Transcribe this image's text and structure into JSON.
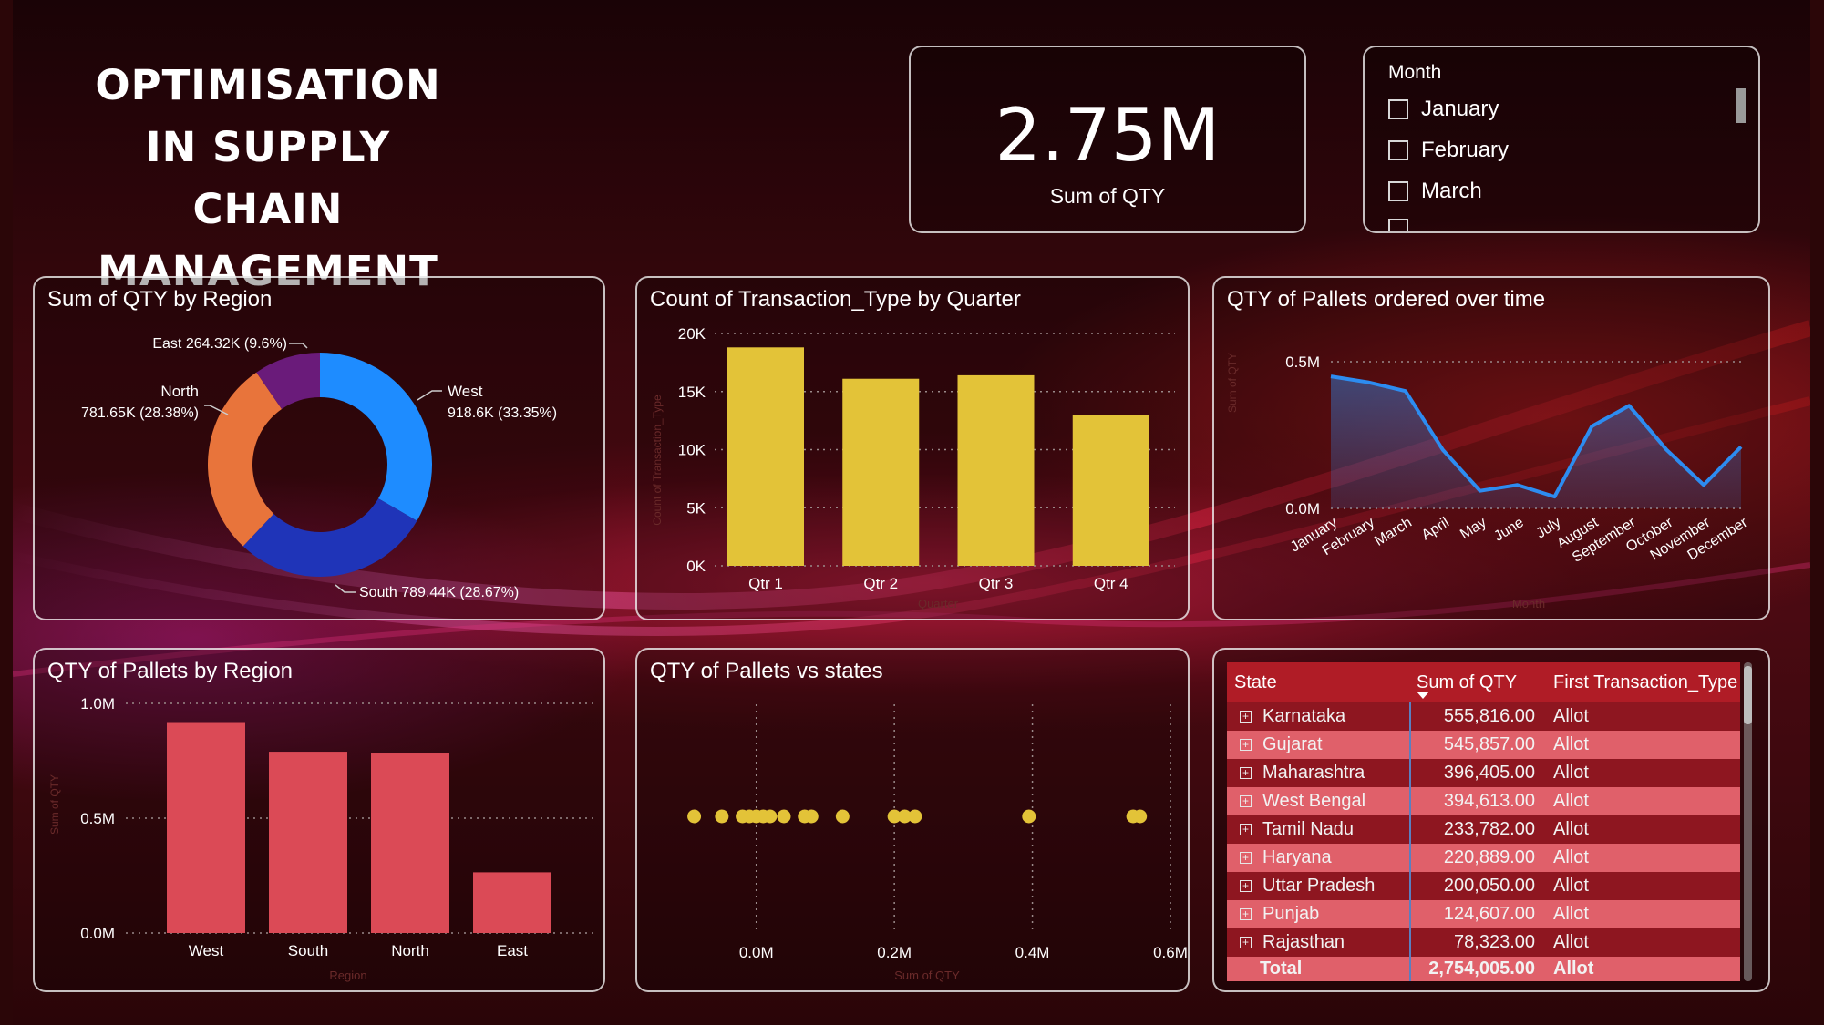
{
  "dashboard": {
    "title_line1": "OPTIMISATION IN SUPPLY",
    "title_line2": "CHAIN MANAGEMENT"
  },
  "kpi": {
    "value": "2.75M",
    "label": "Sum of QTY"
  },
  "month_slicer": {
    "title": "Month",
    "items": [
      "January",
      "February",
      "March"
    ]
  },
  "donut": {
    "title": "Sum of QTY by Region",
    "labels": {
      "east": "East 264.32K (9.6%)",
      "north_name": "North",
      "north_value": "781.65K (28.38%)",
      "west_name": "West",
      "west_value": "918.6K (33.35%)",
      "south": "South 789.44K (28.67%)"
    }
  },
  "quarter_chart": {
    "title": "Count of Transaction_Type by Quarter",
    "xlabel": "Quarter",
    "ylabel": "Count of Transaction_Type"
  },
  "time_chart": {
    "title": "QTY of Pallets ordered over time",
    "xlabel": "Month",
    "ylabel": "Sum of QTY"
  },
  "region_bar_chart": {
    "title": "QTY of Pallets by Region",
    "xlabel": "Region",
    "ylabel": "Sum of QTY"
  },
  "scatter_chart": {
    "title": "QTY of Pallets vs states",
    "xlabel": "Sum of QTY"
  },
  "state_table": {
    "headers": [
      "State",
      "Sum of QTY",
      "First Transaction_Type"
    ],
    "rows": [
      {
        "state": "Karnataka",
        "qty": "555,816.00",
        "type": "Allot"
      },
      {
        "state": "Gujarat",
        "qty": "545,857.00",
        "type": "Allot"
      },
      {
        "state": "Maharashtra",
        "qty": "396,405.00",
        "type": "Allot"
      },
      {
        "state": "West Bengal",
        "qty": "394,613.00",
        "type": "Allot"
      },
      {
        "state": "Tamil Nadu",
        "qty": "233,782.00",
        "type": "Allot"
      },
      {
        "state": "Haryana",
        "qty": "220,889.00",
        "type": "Allot"
      },
      {
        "state": "Uttar Pradesh",
        "qty": "200,050.00",
        "type": "Allot"
      },
      {
        "state": "Punjab",
        "qty": "124,607.00",
        "type": "Allot"
      },
      {
        "state": "Rajasthan",
        "qty": "78,323.00",
        "type": "Allot"
      }
    ],
    "total": {
      "state": "Total",
      "qty": "2,754,005.00",
      "type": "Allot"
    }
  },
  "colors": {
    "west": "#1e8cff",
    "south": "#1f34b8",
    "north": "#e8743b",
    "east": "#6a1b7a",
    "yellow_bar": "#e3c338",
    "red_bar": "#db4a56",
    "line": "#2d8cf0",
    "table_header": "#b01c26",
    "table_dark_row": "#8e1620",
    "table_light_row": "#e0606a"
  },
  "chart_data": [
    {
      "type": "pie",
      "title": "Sum of QTY by Region",
      "categories": [
        "West",
        "South",
        "North",
        "East"
      ],
      "values": [
        918600,
        789440,
        781650,
        264320
      ],
      "percent": [
        33.35,
        28.67,
        28.38,
        9.6
      ],
      "donut": true
    },
    {
      "type": "bar",
      "title": "Count of Transaction_Type by Quarter",
      "categories": [
        "Qtr 1",
        "Qtr 2",
        "Qtr 3",
        "Qtr 4"
      ],
      "values": [
        18800,
        16100,
        16400,
        13000
      ],
      "ylim": [
        0,
        20000
      ],
      "yticks": [
        "0K",
        "5K",
        "10K",
        "15K",
        "20K"
      ],
      "xlabel": "Quarter",
      "ylabel": "Count of Transaction_Type"
    },
    {
      "type": "area",
      "title": "QTY of Pallets ordered over time",
      "categories": [
        "January",
        "February",
        "March",
        "April",
        "May",
        "June",
        "July",
        "August",
        "September",
        "October",
        "November",
        "December"
      ],
      "values": [
        0.45,
        0.43,
        0.4,
        0.2,
        0.06,
        0.08,
        0.04,
        0.28,
        0.35,
        0.2,
        0.08,
        0.21
      ],
      "ylim": [
        0,
        0.5
      ],
      "yticks": [
        "0.0M",
        "0.5M"
      ],
      "xlabel": "Month",
      "ylabel": "Sum of QTY"
    },
    {
      "type": "bar",
      "title": "QTY of Pallets by Region",
      "categories": [
        "West",
        "South",
        "North",
        "East"
      ],
      "values": [
        0.9186,
        0.7894,
        0.7817,
        0.2643
      ],
      "ylim": [
        0,
        1.0
      ],
      "yticks": [
        "0.0M",
        "0.5M",
        "1.0M"
      ],
      "xlabel": "Region",
      "ylabel": "Sum of QTY"
    },
    {
      "type": "scatter",
      "title": "QTY of Pallets vs states",
      "x": [
        -0.09,
        -0.05,
        -0.02,
        -0.01,
        0.0,
        0.01,
        0.02,
        0.04,
        0.07,
        0.08,
        0.125,
        0.2,
        0.215,
        0.23,
        0.395,
        0.546,
        0.556
      ],
      "xlim": [
        -0.1,
        0.6
      ],
      "xticks": [
        "0.0M",
        "0.2M",
        "0.4M",
        "0.6M"
      ],
      "xlabel": "Sum of QTY"
    }
  ]
}
